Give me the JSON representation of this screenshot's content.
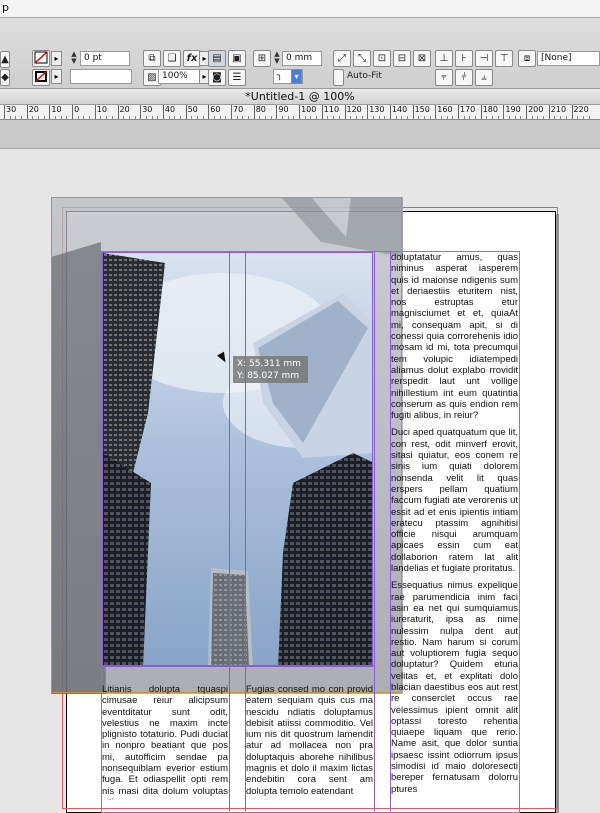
{
  "app": {
    "menu_fragment": "p"
  },
  "control_panel": {
    "stroke_weight": "0 pt",
    "scale": "100%",
    "offset_value": "0 mm",
    "auto_fit_label": "Auto-Fit",
    "object_style": "[None]"
  },
  "document": {
    "tab_title": "*Untitled-1 @ 100%"
  },
  "ruler": {
    "labels": [
      "30",
      "20",
      "10",
      "0",
      "10",
      "20",
      "30",
      "40",
      "50",
      "60",
      "70",
      "80",
      "90",
      "100",
      "110",
      "120",
      "130",
      "140",
      "150",
      "160",
      "170",
      "180",
      "190",
      "200",
      "210",
      "220"
    ]
  },
  "tooltip": {
    "x": "X: 55.311 mm",
    "y": "Y: 85.027 mm"
  },
  "text": {
    "right_col_1": "doluptatatur amus, quas niminus asperat iasperem quis id maionse ndigenis sum et deriaestiis eturitem nist, nos estruptas etur magnisciumet et et, quiaAt mi, consequam apit, si di conessi quia corrorehenis idio mosam id mi, tota precumqui tem volupic idiatempedi aliamus dolut explabo rrovidit rerspedit laut unt vollige nihillestium int eum quatintia conserum as quis endion rem fugiti alibus, in reiur?",
    "right_col_2": "Duci aped quatquatum que lit, con rest, odit minverf erovit, sitasi quiatur, eos conem re sinis ium quiati dolorem nonsenda velit lit quas erspers pellam quatium faccum fugiati ate verorenis ut essit ad et enis ipientis intiam eratecu ptassim agnihitisi officie nisqui arumquam apicaes essin cum eat dollaborion ratem lat alit landelias et fugiate proritatus.",
    "right_col_3": "Essequatius nimus expelique rae parumendicia inim faci asin ea net qui sumquiamus iureraturit, ipsa as nime nulessim nulpa dent aut restio. Nam harum si corum aut voluptiorem fugia sequo doluptatur? Quidem eturia velitas et, et explitati dolo blacian daestibus eos aut rest re conserclet occus rae velessimus ipient omnit alit optassi toresto rehentia quiaepe liquam que rerio. Name asit, que dolor suntia ipsaesc issint odiorrum ipsus simodisi id maio doloresecti bereper fernatusam dolorru ptures",
    "left_col": "Litianis dolupta tquaspi cimusae reiur alicipsum eventditatur sunt odit, velestius ne maxim incte plignisto totaturio. Pudi duciat in nonpro beatiant que pos mi, autofficim sendae pa nonsequiblam everior estium fuga. Et odiaspellit opti rem nis masi dita dolum voluptas sitis",
    "mid_col": "Fugias consed mo con provid eatem sequiam quis cus ma nescidu ndiatis doluptamus debisit atiissi commoditio. Vel ium nis dit quostrum lamendit atur ad mollacea non pra doluptaquis aborehe nihilibus magnis et dolo il maxim lictas endebitin cora sent am dolupta temolo eatendant"
  }
}
